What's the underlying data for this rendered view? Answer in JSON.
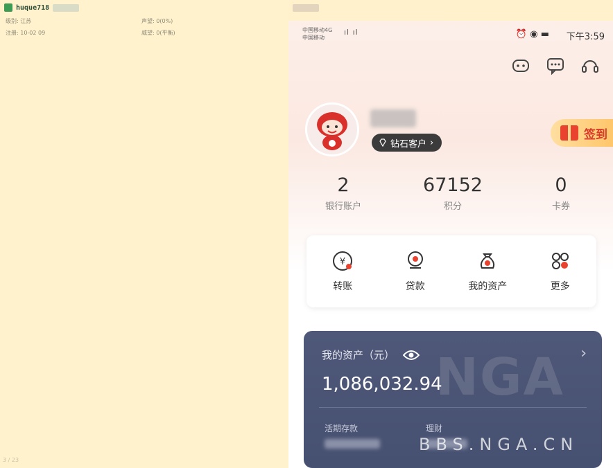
{
  "forum": {
    "username": "huque718",
    "tag": "",
    "meta": {
      "row1_left": "级别: 江苏",
      "row1_right": "声望: 0(0%)",
      "row2_left": "注册: 10-02 09",
      "row2_right": "威望: 0(平衡)"
    },
    "page_indicator": "3 / 23"
  },
  "phone": {
    "status": {
      "carrier_line1": "中国移动4G",
      "carrier_line2": "中国移动",
      "signal": "ıl ıl",
      "icons": "⏰ ◉ ▬",
      "time": "下午3:59"
    },
    "top_icons": [
      "robot-icon",
      "message-icon",
      "headset-icon"
    ],
    "profile": {
      "tier": "钻石客户",
      "signin_label": "签到"
    },
    "stats": [
      {
        "value": "2",
        "label": "银行账户"
      },
      {
        "value": "67152",
        "label": "积分"
      },
      {
        "value": "0",
        "label": "卡券"
      }
    ],
    "quick_actions": [
      {
        "label": "转账",
        "icon": "transfer-icon"
      },
      {
        "label": "贷款",
        "icon": "loan-icon"
      },
      {
        "label": "我的资产",
        "icon": "money-bag-icon"
      },
      {
        "label": "更多",
        "icon": "more-grid-icon"
      }
    ],
    "assets": {
      "title": "我的资产（元）",
      "amount": "1,086,032.94",
      "sub_left_label": "活期存款",
      "sub_right_label": "理财"
    },
    "watermark": {
      "logo": "NGA",
      "url": "BBS.NGA.CN"
    }
  }
}
